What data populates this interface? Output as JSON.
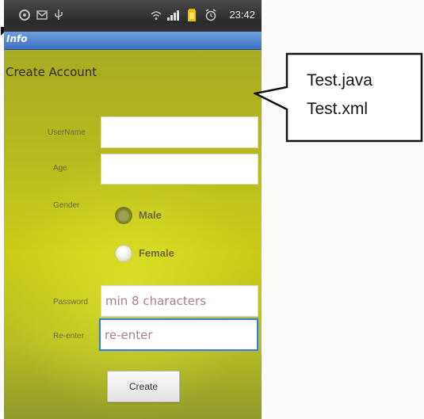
{
  "status_bar": {
    "time": "23:42",
    "icons": [
      "app-icon",
      "notification-icon",
      "usb-icon",
      "wifi-icon",
      "signal-icon",
      "battery-icon",
      "alarm-icon"
    ]
  },
  "title_bar": {
    "title": "Info"
  },
  "form": {
    "heading": "Create Account",
    "username_label": "UserName",
    "username_value": "",
    "age_label": "Age",
    "age_value": "",
    "gender_label": "Gender",
    "gender_options": [
      "Male",
      "Female"
    ],
    "password_label": "Password",
    "password_placeholder": "min 8 characters",
    "reenter_label": "Re-enter",
    "reenter_placeholder": "re-enter",
    "create_button": "Create"
  },
  "callout": {
    "lines": [
      "Test.java",
      "Test.xml"
    ]
  },
  "colors": {
    "title_bar": "#4a7fd0",
    "background_yellow": "#c9cd18",
    "focus_border": "#3e7bd6"
  }
}
